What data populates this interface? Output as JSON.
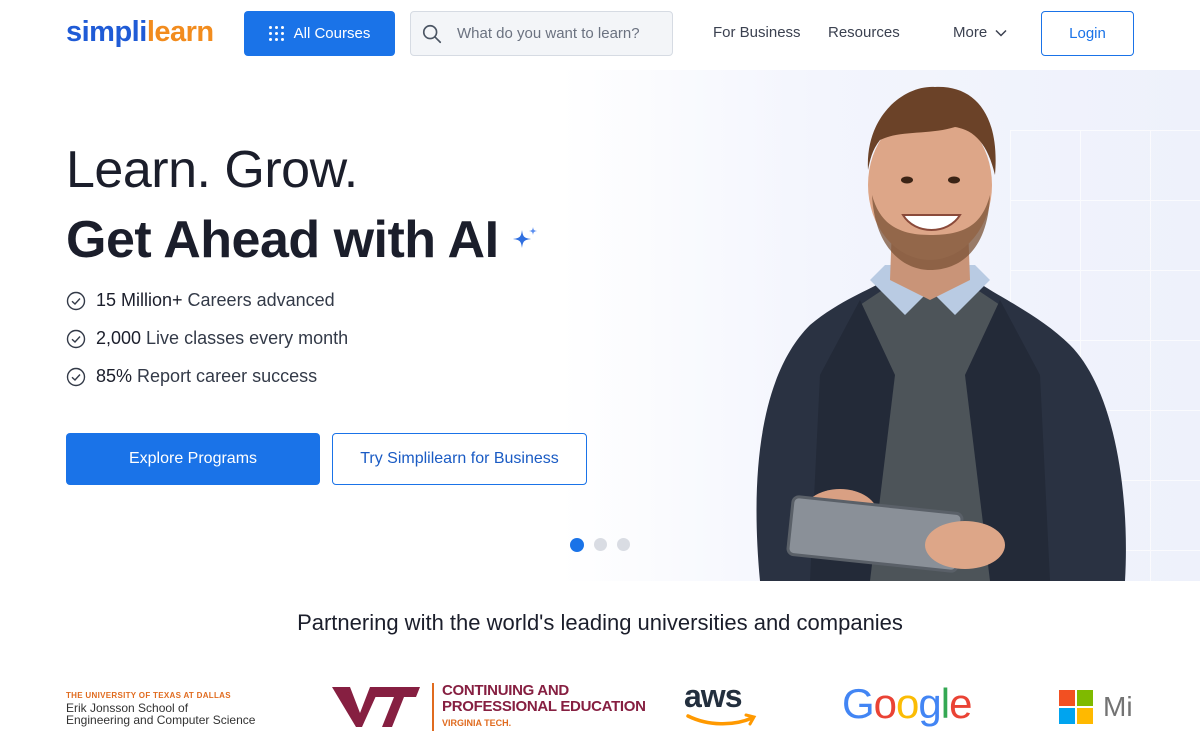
{
  "header": {
    "logo": {
      "part1": "simpl",
      "part2": "i",
      "part3": "learn"
    },
    "all_courses_label": "All Courses",
    "search_placeholder": "What do you want to learn?",
    "nav": {
      "business": "For Business",
      "resources": "Resources",
      "more": "More"
    },
    "login_label": "Login"
  },
  "hero": {
    "headline1": "Learn. Grow.",
    "headline2": "Get Ahead with AI",
    "stats": [
      {
        "number": "15 Million+",
        "text": "Careers advanced"
      },
      {
        "number": "2,000",
        "text": "Live classes every month"
      },
      {
        "number": "85%",
        "text": "Report career success"
      }
    ],
    "primary_cta": "Explore Programs",
    "secondary_cta": "Try Simplilearn for Business",
    "carousel": {
      "total_slides": 3,
      "active_slide": 1
    }
  },
  "partners": {
    "title": "Partnering with the world's leading universities and companies",
    "utd": {
      "line1": "THE UNIVERSITY OF TEXAS AT DALLAS",
      "line2": "Erik Jonsson School of",
      "line3": "Engineering and Computer Science"
    },
    "vt": {
      "mark": "VT",
      "line1": "CONTINUING AND",
      "line2": "PROFESSIONAL EDUCATION",
      "line3": "VIRGINIA TECH."
    },
    "aws": "aws",
    "google": "Google",
    "microsoft": "Mi"
  },
  "colors": {
    "primary": "#1a73e8",
    "logo_blue": "#1f5bd6",
    "logo_orange": "#f28c1e",
    "vt_maroon": "#861f41",
    "vt_orange": "#e06b1f"
  }
}
